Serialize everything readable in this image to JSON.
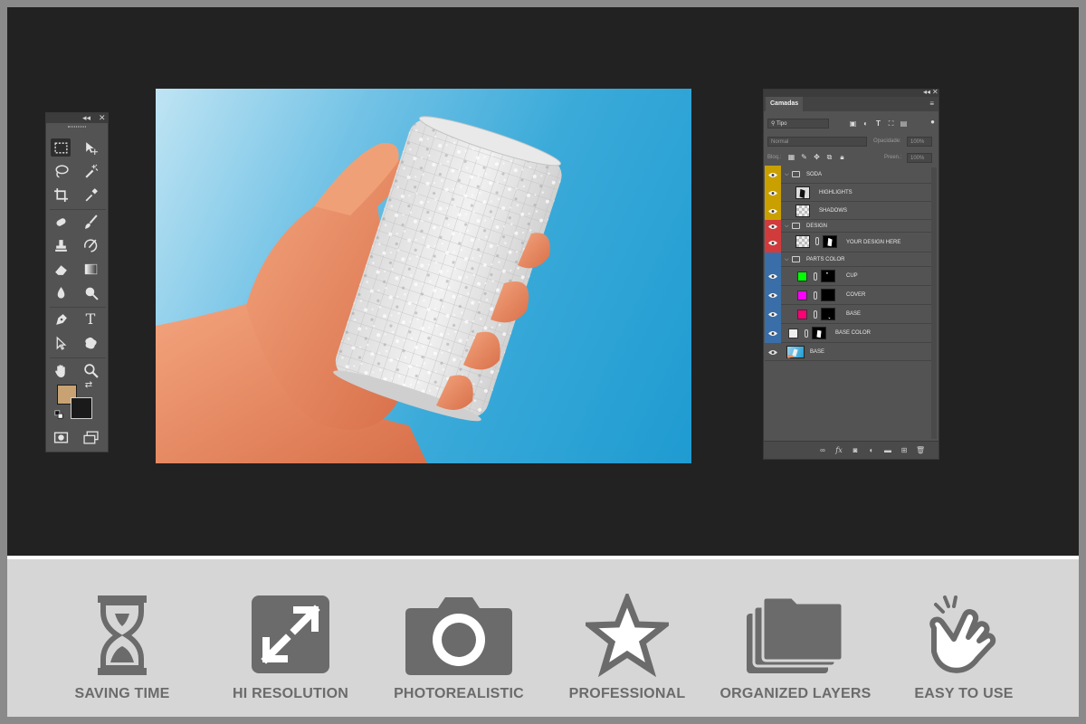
{
  "tools_panel": {
    "collapse_label": "◂◂",
    "close_label": "✕",
    "fg_color": "#c8a273",
    "bg_color": "#1a1a1a"
  },
  "layers_panel": {
    "tab_label": "Camadas",
    "filter_value": "Tipo",
    "blend_mode": "Normal",
    "opacity_label": "Opacidade:",
    "opacity_value": "100%",
    "lock_label": "Bloq.:",
    "fill_label": "Preen.:",
    "fill_value": "100%",
    "layers": [
      {
        "name": "SODA",
        "type": "group",
        "tag_color": "#c9a000"
      },
      {
        "name": "HIGHLIGHTS",
        "type": "layer",
        "tag_color": "#c9a000"
      },
      {
        "name": "SHADOWS",
        "type": "layer",
        "tag_color": "#c9a000"
      },
      {
        "name": "DESIGN",
        "type": "group",
        "tag_color": "#d23b3b"
      },
      {
        "name": "YOUR DESIGN HERE",
        "type": "smart",
        "tag_color": "#d23b3b"
      },
      {
        "name": "PARTS COLOR",
        "type": "group",
        "tag_color": "#3a6ea8"
      },
      {
        "name": "CUP",
        "type": "fill",
        "tag_color": "#3a6ea8",
        "swatch": "#00ff00"
      },
      {
        "name": "COVER",
        "type": "fill",
        "tag_color": "#3a6ea8",
        "swatch": "#ff00ff"
      },
      {
        "name": "BASE",
        "type": "fill",
        "tag_color": "#3a6ea8",
        "swatch": "#ff0077"
      },
      {
        "name": "BASE COLOR",
        "type": "fill",
        "tag_color": "#3a6ea8",
        "swatch": "#eeeeee"
      },
      {
        "name": "BASE",
        "type": "image",
        "tag_color": "#5a5a5a"
      }
    ]
  },
  "features": [
    {
      "label": "SAVING TIME",
      "icon": "hourglass-icon"
    },
    {
      "label": "HI RESOLUTION",
      "icon": "expand-icon"
    },
    {
      "label": "PHOTOREALISTIC",
      "icon": "camera-icon"
    },
    {
      "label": "PROFESSIONAL",
      "icon": "star-icon"
    },
    {
      "label": "ORGANIZED LAYERS",
      "icon": "layers-icon"
    },
    {
      "label": "EASY TO USE",
      "icon": "tap-hand-icon"
    }
  ],
  "colors": {
    "workspace": "#222222",
    "feature_bg": "#d6d6d6",
    "feature_icon": "#6b6b6b",
    "sky": "#1f9bd1"
  }
}
